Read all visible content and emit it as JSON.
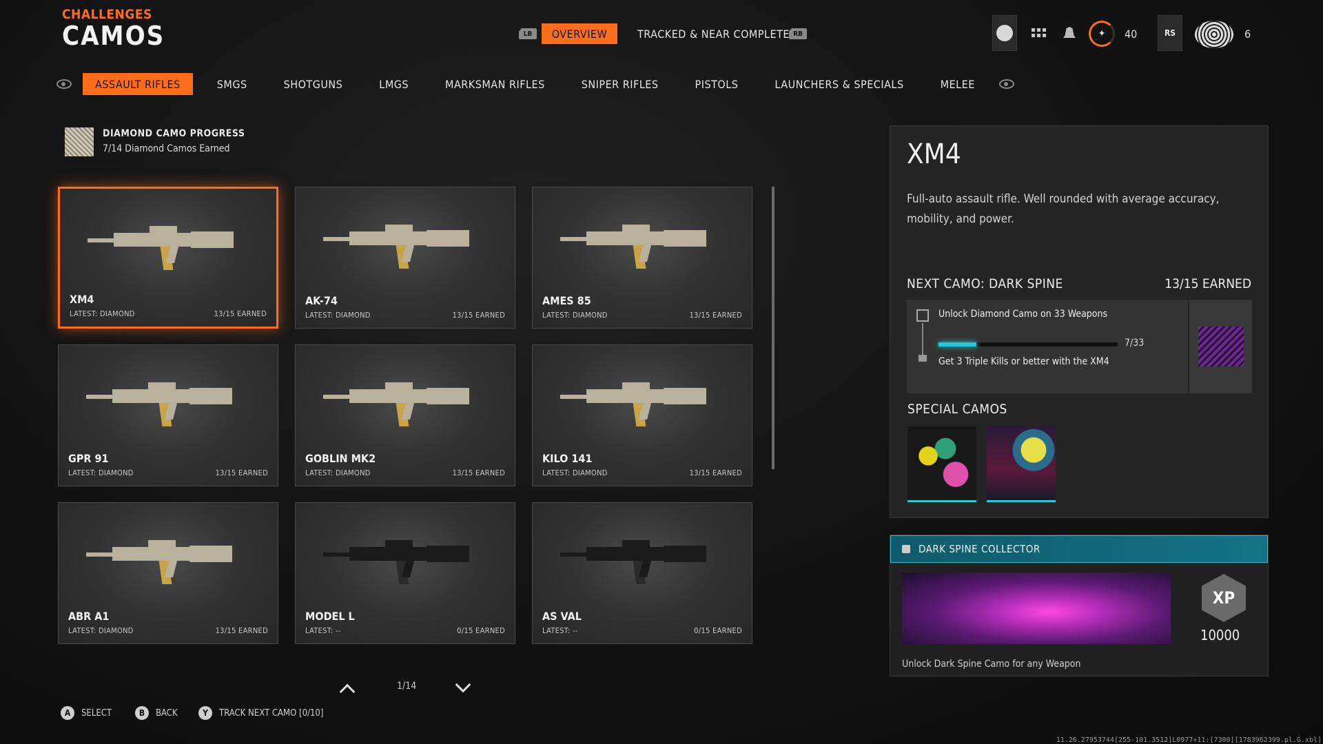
{
  "header": {
    "subtitle": "CHALLENGES",
    "title": "CAMOS"
  },
  "top_nav": {
    "left_bumper": "LB",
    "right_bumper": "RB",
    "tabs": [
      {
        "label": "OVERVIEW",
        "active": true
      },
      {
        "label": "TRACKED & NEAR COMPLETE",
        "active": false
      }
    ]
  },
  "status": {
    "rank": "40",
    "prestige_count": "6",
    "rs_label": "RS"
  },
  "categories": [
    {
      "label": "ASSAULT RIFLES",
      "active": true
    },
    {
      "label": "SMGS"
    },
    {
      "label": "SHOTGUNS"
    },
    {
      "label": "LMGS"
    },
    {
      "label": "MARKSMAN RIFLES"
    },
    {
      "label": "SNIPER RIFLES"
    },
    {
      "label": "PISTOLS"
    },
    {
      "label": "LAUNCHERS & SPECIALS"
    },
    {
      "label": "MELEE"
    }
  ],
  "progress": {
    "title": "DIAMOND CAMO PROGRESS",
    "subtitle": "7/14 Diamond Camos Earned"
  },
  "weapons": [
    {
      "name": "XM4",
      "latest": "LATEST: DIAMOND",
      "earned": "13/15 EARNED",
      "selected": true
    },
    {
      "name": "AK-74",
      "latest": "LATEST: DIAMOND",
      "earned": "13/15 EARNED"
    },
    {
      "name": "AMES 85",
      "latest": "LATEST: DIAMOND",
      "earned": "13/15 EARNED"
    },
    {
      "name": "GPR 91",
      "latest": "LATEST: DIAMOND",
      "earned": "13/15 EARNED"
    },
    {
      "name": "GOBLIN MK2",
      "latest": "LATEST: DIAMOND",
      "earned": "13/15 EARNED"
    },
    {
      "name": "KILO 141",
      "latest": "LATEST: DIAMOND",
      "earned": "13/15 EARNED"
    },
    {
      "name": "ABR A1",
      "latest": "LATEST: DIAMOND",
      "earned": "13/15 EARNED"
    },
    {
      "name": "MODEL L",
      "latest": "LATEST: --",
      "earned": "0/15 EARNED"
    },
    {
      "name": "AS VAL",
      "latest": "LATEST: --",
      "earned": "0/15 EARNED"
    }
  ],
  "pager": {
    "text": "1/14"
  },
  "footer": [
    {
      "key": "A",
      "label": "SELECT"
    },
    {
      "key": "B",
      "label": "BACK"
    },
    {
      "key": "Y",
      "label": "TRACK NEXT CAMO [0/10]"
    }
  ],
  "detail": {
    "title": "XM4",
    "description": "Full-auto assault rifle.  Well rounded with average accuracy, mobility, and power.",
    "next_camo": "NEXT CAMO: DARK SPINE",
    "next_earned": "13/15 EARNED",
    "challenge_1": "Unlock Diamond Camo on 33 Weapons",
    "challenge_progress": "7/33",
    "challenge_fraction": 0.212,
    "challenge_2": "Get 3 Triple Kills or better with the XM4",
    "special_title": "SPECIAL CAMOS"
  },
  "collector": {
    "title": "DARK SPINE COLLECTOR",
    "xp_label": "XP",
    "xp": "10000",
    "description": "Unlock Dark Spine Camo for any Weapon"
  },
  "build_string": "11.26.27953744[255-101.3512]L0977+11:[7300][1783962399.pl.G.xbl]",
  "colors": {
    "accent": "#ff6d1a",
    "teal": "#27c7d4",
    "panel": "#242424"
  }
}
